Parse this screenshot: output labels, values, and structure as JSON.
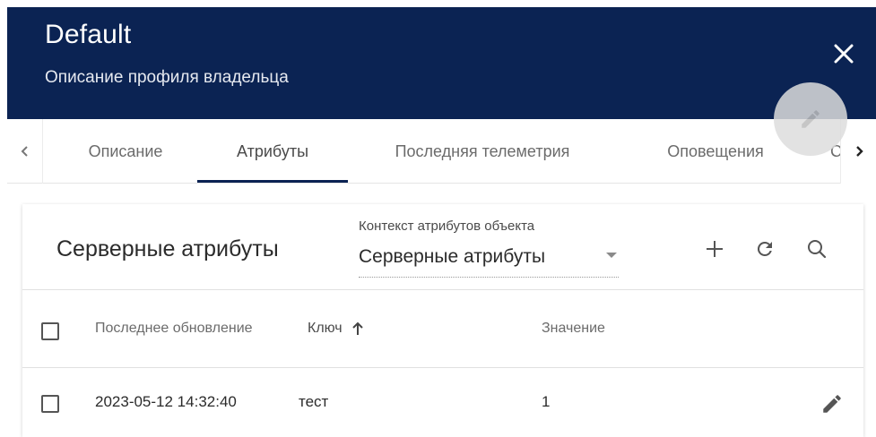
{
  "header": {
    "title": "Default",
    "subtitle": "Описание профиля владельца",
    "background_color": "#0b2353",
    "close_icon": "close-icon"
  },
  "fab": {
    "icon": "edit-icon"
  },
  "tabs": {
    "items": [
      {
        "label": "Описание",
        "active": false
      },
      {
        "label": "Атрибуты",
        "active": true
      },
      {
        "label": "Последняя телеметрия",
        "active": false
      },
      {
        "label": "Оповещения",
        "active": false
      },
      {
        "label": "С",
        "active": false
      }
    ],
    "left_arrow_icon": "chevron-left-icon",
    "right_arrow_icon": "chevron-right-icon"
  },
  "attributes_panel": {
    "title": "Серверные атрибуты",
    "context_label": "Контекст атрибутов объекта",
    "context_value": "Серверные атрибуты",
    "toolbar_icons": [
      "add-icon",
      "refresh-icon",
      "search-icon"
    ],
    "table": {
      "columns": [
        "Последнее обновление",
        "Ключ",
        "Значение"
      ],
      "sort_column": "Ключ",
      "sort_direction": "ascending",
      "rows": [
        {
          "last_update": "2023-05-12 14:32:40",
          "key": "тест",
          "value": "1"
        }
      ]
    }
  }
}
